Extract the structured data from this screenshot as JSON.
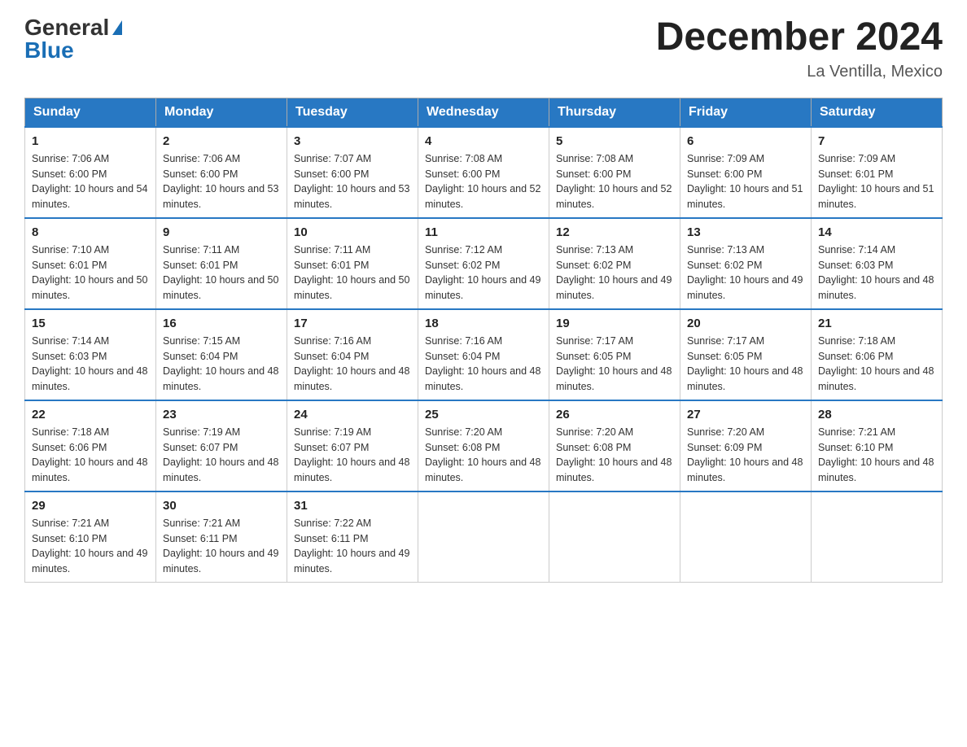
{
  "header": {
    "logo_general": "General",
    "logo_blue": "Blue",
    "month_title": "December 2024",
    "location": "La Ventilla, Mexico"
  },
  "days_of_week": [
    "Sunday",
    "Monday",
    "Tuesday",
    "Wednesday",
    "Thursday",
    "Friday",
    "Saturday"
  ],
  "weeks": [
    [
      {
        "day": 1,
        "sunrise": "7:06 AM",
        "sunset": "6:00 PM",
        "daylight": "10 hours and 54 minutes."
      },
      {
        "day": 2,
        "sunrise": "7:06 AM",
        "sunset": "6:00 PM",
        "daylight": "10 hours and 53 minutes."
      },
      {
        "day": 3,
        "sunrise": "7:07 AM",
        "sunset": "6:00 PM",
        "daylight": "10 hours and 53 minutes."
      },
      {
        "day": 4,
        "sunrise": "7:08 AM",
        "sunset": "6:00 PM",
        "daylight": "10 hours and 52 minutes."
      },
      {
        "day": 5,
        "sunrise": "7:08 AM",
        "sunset": "6:00 PM",
        "daylight": "10 hours and 52 minutes."
      },
      {
        "day": 6,
        "sunrise": "7:09 AM",
        "sunset": "6:00 PM",
        "daylight": "10 hours and 51 minutes."
      },
      {
        "day": 7,
        "sunrise": "7:09 AM",
        "sunset": "6:01 PM",
        "daylight": "10 hours and 51 minutes."
      }
    ],
    [
      {
        "day": 8,
        "sunrise": "7:10 AM",
        "sunset": "6:01 PM",
        "daylight": "10 hours and 50 minutes."
      },
      {
        "day": 9,
        "sunrise": "7:11 AM",
        "sunset": "6:01 PM",
        "daylight": "10 hours and 50 minutes."
      },
      {
        "day": 10,
        "sunrise": "7:11 AM",
        "sunset": "6:01 PM",
        "daylight": "10 hours and 50 minutes."
      },
      {
        "day": 11,
        "sunrise": "7:12 AM",
        "sunset": "6:02 PM",
        "daylight": "10 hours and 49 minutes."
      },
      {
        "day": 12,
        "sunrise": "7:13 AM",
        "sunset": "6:02 PM",
        "daylight": "10 hours and 49 minutes."
      },
      {
        "day": 13,
        "sunrise": "7:13 AM",
        "sunset": "6:02 PM",
        "daylight": "10 hours and 49 minutes."
      },
      {
        "day": 14,
        "sunrise": "7:14 AM",
        "sunset": "6:03 PM",
        "daylight": "10 hours and 48 minutes."
      }
    ],
    [
      {
        "day": 15,
        "sunrise": "7:14 AM",
        "sunset": "6:03 PM",
        "daylight": "10 hours and 48 minutes."
      },
      {
        "day": 16,
        "sunrise": "7:15 AM",
        "sunset": "6:04 PM",
        "daylight": "10 hours and 48 minutes."
      },
      {
        "day": 17,
        "sunrise": "7:16 AM",
        "sunset": "6:04 PM",
        "daylight": "10 hours and 48 minutes."
      },
      {
        "day": 18,
        "sunrise": "7:16 AM",
        "sunset": "6:04 PM",
        "daylight": "10 hours and 48 minutes."
      },
      {
        "day": 19,
        "sunrise": "7:17 AM",
        "sunset": "6:05 PM",
        "daylight": "10 hours and 48 minutes."
      },
      {
        "day": 20,
        "sunrise": "7:17 AM",
        "sunset": "6:05 PM",
        "daylight": "10 hours and 48 minutes."
      },
      {
        "day": 21,
        "sunrise": "7:18 AM",
        "sunset": "6:06 PM",
        "daylight": "10 hours and 48 minutes."
      }
    ],
    [
      {
        "day": 22,
        "sunrise": "7:18 AM",
        "sunset": "6:06 PM",
        "daylight": "10 hours and 48 minutes."
      },
      {
        "day": 23,
        "sunrise": "7:19 AM",
        "sunset": "6:07 PM",
        "daylight": "10 hours and 48 minutes."
      },
      {
        "day": 24,
        "sunrise": "7:19 AM",
        "sunset": "6:07 PM",
        "daylight": "10 hours and 48 minutes."
      },
      {
        "day": 25,
        "sunrise": "7:20 AM",
        "sunset": "6:08 PM",
        "daylight": "10 hours and 48 minutes."
      },
      {
        "day": 26,
        "sunrise": "7:20 AM",
        "sunset": "6:08 PM",
        "daylight": "10 hours and 48 minutes."
      },
      {
        "day": 27,
        "sunrise": "7:20 AM",
        "sunset": "6:09 PM",
        "daylight": "10 hours and 48 minutes."
      },
      {
        "day": 28,
        "sunrise": "7:21 AM",
        "sunset": "6:10 PM",
        "daylight": "10 hours and 48 minutes."
      }
    ],
    [
      {
        "day": 29,
        "sunrise": "7:21 AM",
        "sunset": "6:10 PM",
        "daylight": "10 hours and 49 minutes."
      },
      {
        "day": 30,
        "sunrise": "7:21 AM",
        "sunset": "6:11 PM",
        "daylight": "10 hours and 49 minutes."
      },
      {
        "day": 31,
        "sunrise": "7:22 AM",
        "sunset": "6:11 PM",
        "daylight": "10 hours and 49 minutes."
      },
      null,
      null,
      null,
      null
    ]
  ]
}
